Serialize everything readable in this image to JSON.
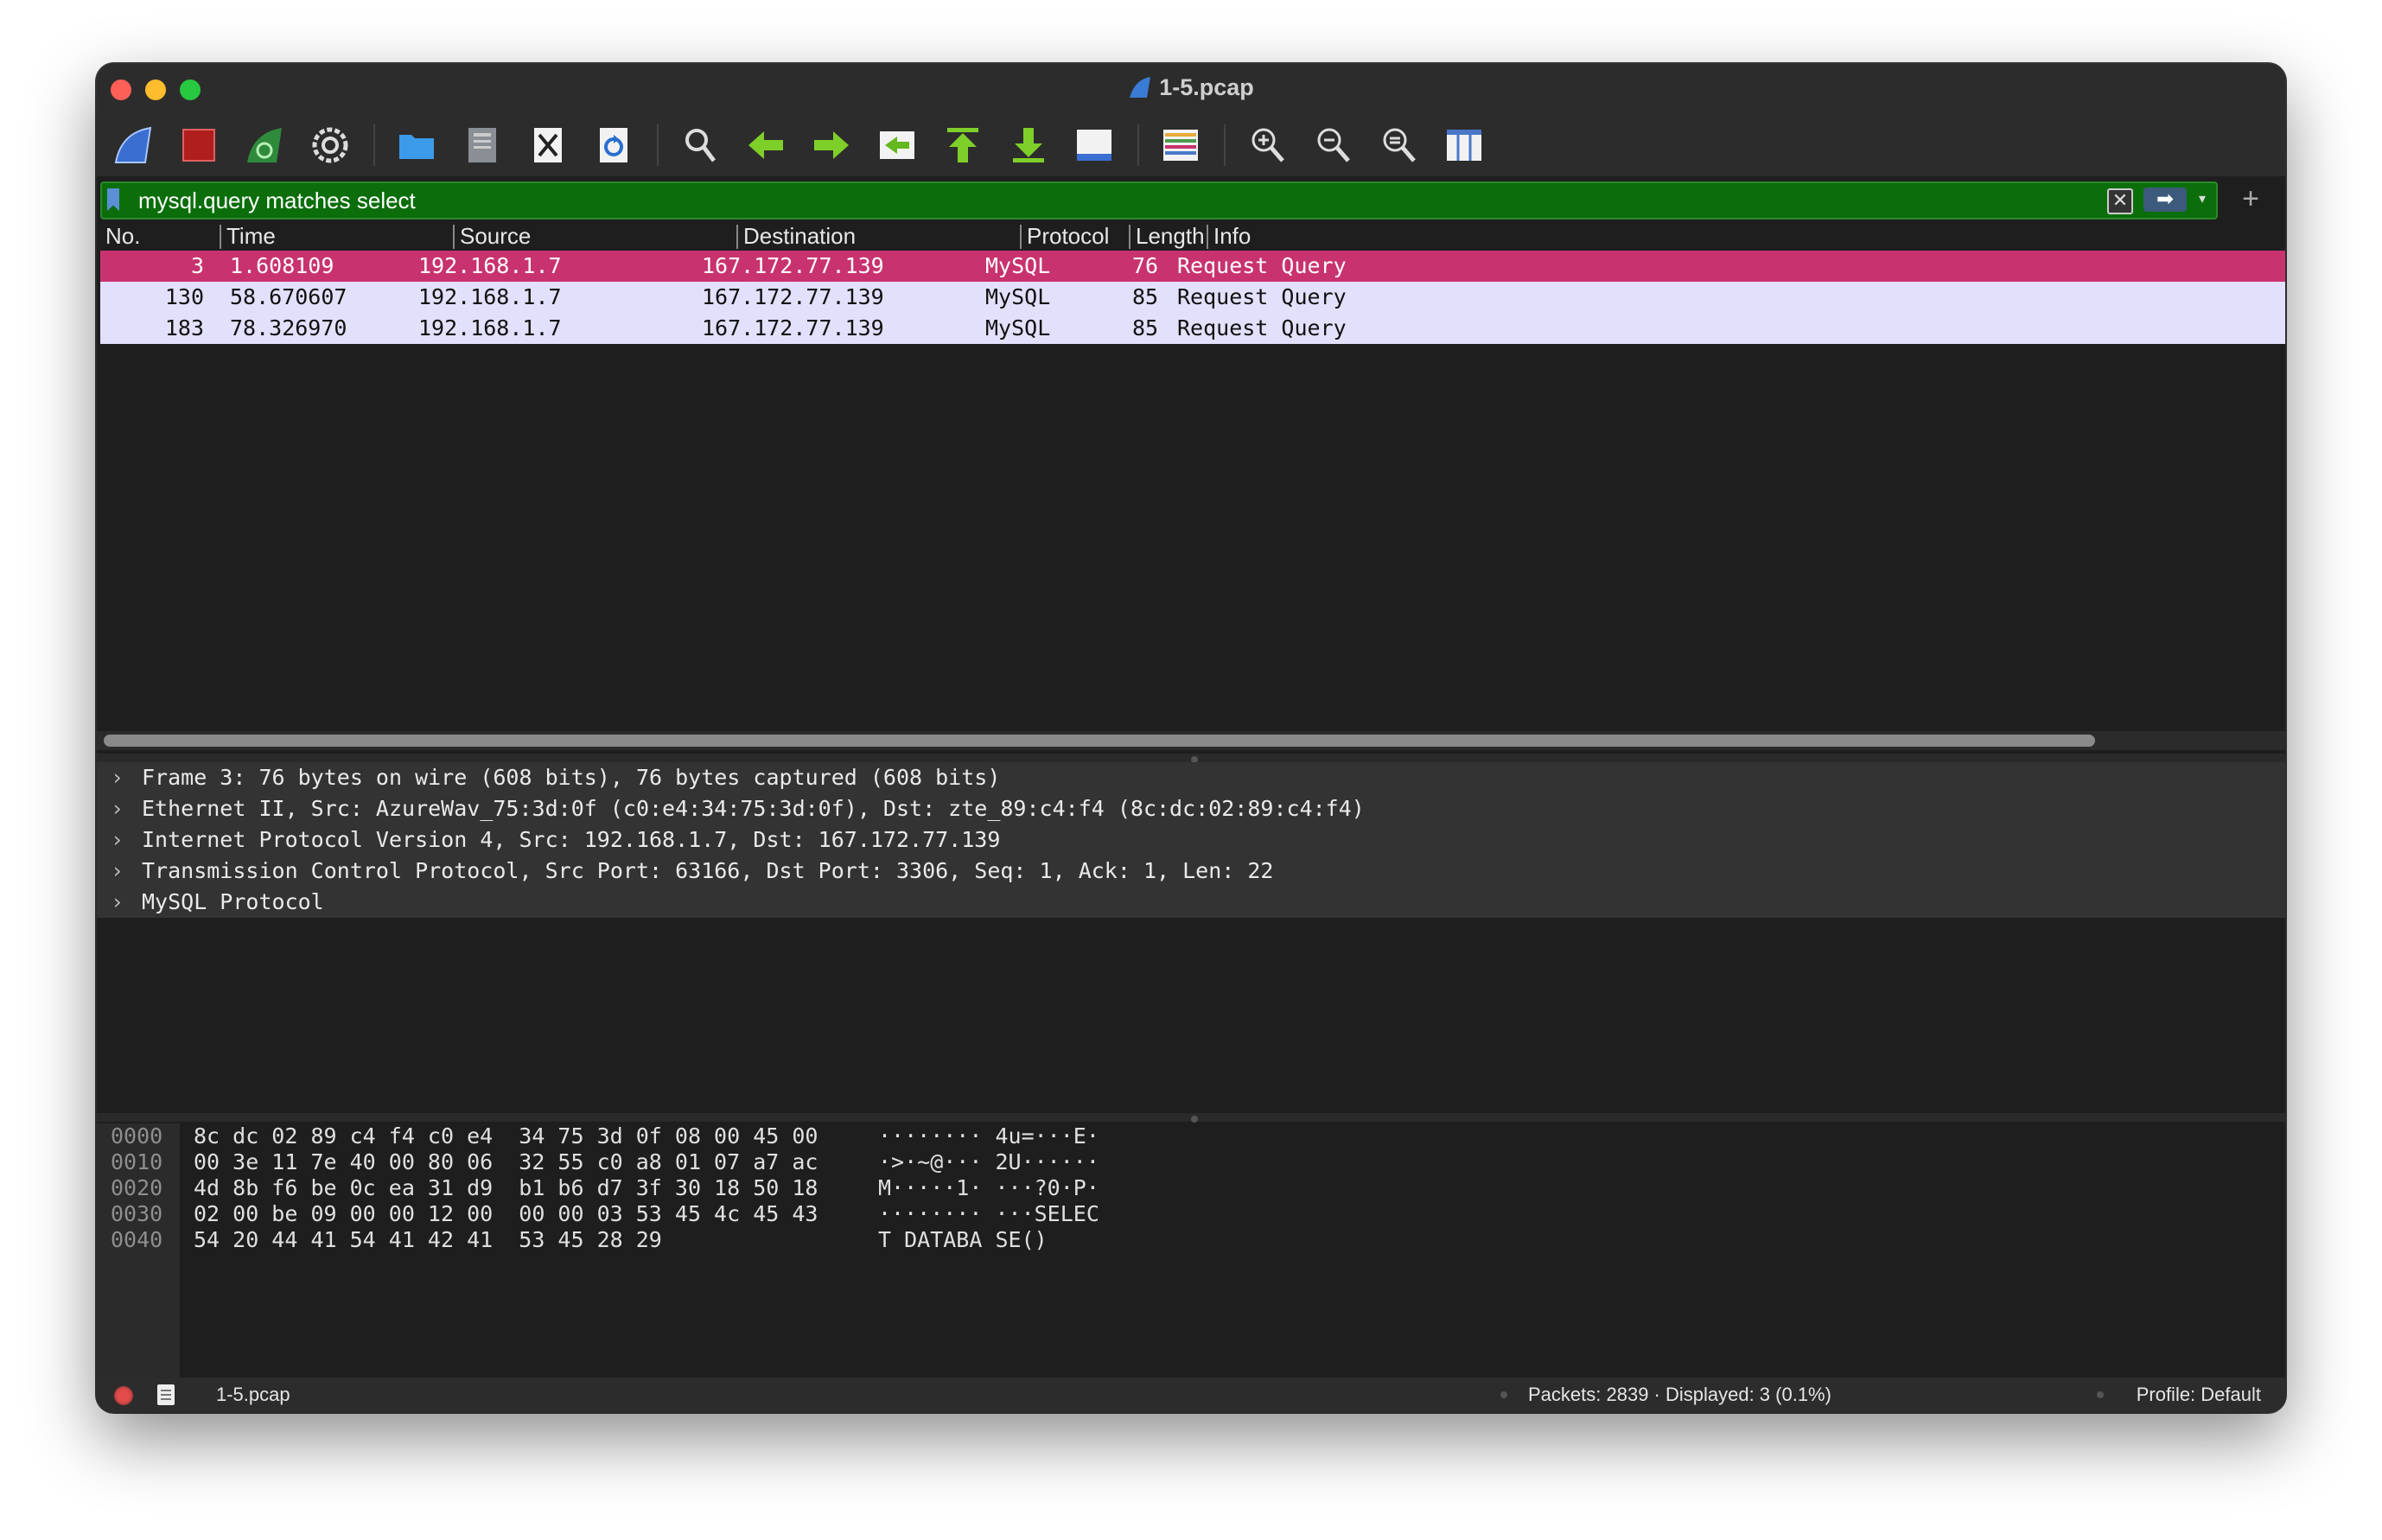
{
  "window": {
    "title": "1-5.pcap"
  },
  "toolbar": {
    "buttons": [
      "start-capture",
      "stop-capture",
      "restart-capture",
      "capture-options",
      "open-file",
      "save-file",
      "close-file",
      "reload-file",
      "find-packet",
      "go-back",
      "go-forward",
      "go-to-packet",
      "go-first",
      "go-last",
      "auto-scroll",
      "colorize",
      "zoom-in",
      "zoom-out",
      "zoom-reset",
      "resize-columns"
    ]
  },
  "filter": {
    "value": "mysql.query matches select",
    "clear_icon": "✕",
    "apply_icon": "➡",
    "dropdown_icon": "▾",
    "add_icon": "+"
  },
  "packet_list": {
    "columns": [
      "No.",
      "Time",
      "Source",
      "Destination",
      "Protocol",
      "Length",
      "Info"
    ],
    "rows": [
      {
        "no": "3",
        "time": "1.608109",
        "source": "192.168.1.7",
        "destination": "167.172.77.139",
        "protocol": "MySQL",
        "length": "76",
        "info": "Request Query"
      },
      {
        "no": "130",
        "time": "58.670607",
        "source": "192.168.1.7",
        "destination": "167.172.77.139",
        "protocol": "MySQL",
        "length": "85",
        "info": "Request Query"
      },
      {
        "no": "183",
        "time": "78.326970",
        "source": "192.168.1.7",
        "destination": "167.172.77.139",
        "protocol": "MySQL",
        "length": "85",
        "info": "Request Query"
      }
    ]
  },
  "details": {
    "rows": [
      "Frame 3: 76 bytes on wire (608 bits), 76 bytes captured (608 bits)",
      "Ethernet II, Src: AzureWav_75:3d:0f (c0:e4:34:75:3d:0f), Dst: zte_89:c4:f4 (8c:dc:02:89:c4:f4)",
      "Internet Protocol Version 4, Src: 192.168.1.7, Dst: 167.172.77.139",
      "Transmission Control Protocol, Src Port: 63166, Dst Port: 3306, Seq: 1, Ack: 1, Len: 22",
      "MySQL Protocol"
    ],
    "chevron": "›"
  },
  "bytes": {
    "rows": [
      {
        "offset": "0000",
        "hex": "8c dc 02 89 c4 f4 c0 e4  34 75 3d 0f 08 00 45 00",
        "ascii": "········ 4u=···E·"
      },
      {
        "offset": "0010",
        "hex": "00 3e 11 7e 40 00 80 06  32 55 c0 a8 01 07 a7 ac",
        "ascii": "·>·~@··· 2U······"
      },
      {
        "offset": "0020",
        "hex": "4d 8b f6 be 0c ea 31 d9  b1 b6 d7 3f 30 18 50 18",
        "ascii": "M·····1· ···?0·P·"
      },
      {
        "offset": "0030",
        "hex": "02 00 be 09 00 00 12 00  00 00 03 53 45 4c 45 43",
        "ascii": "········ ···SELEC"
      },
      {
        "offset": "0040",
        "hex": "54 20 44 41 54 41 42 41  53 45 28 29",
        "ascii": "T DATABA SE()"
      }
    ]
  },
  "status": {
    "file": "1-5.pcap",
    "packets": "Packets: 2839 · Displayed: 3 (0.1%)",
    "profile": "Profile: Default"
  },
  "colors": {
    "selected_row": "#c8336f",
    "normal_row": "#e3e0fb",
    "filter_valid": "#0b6e0b"
  }
}
